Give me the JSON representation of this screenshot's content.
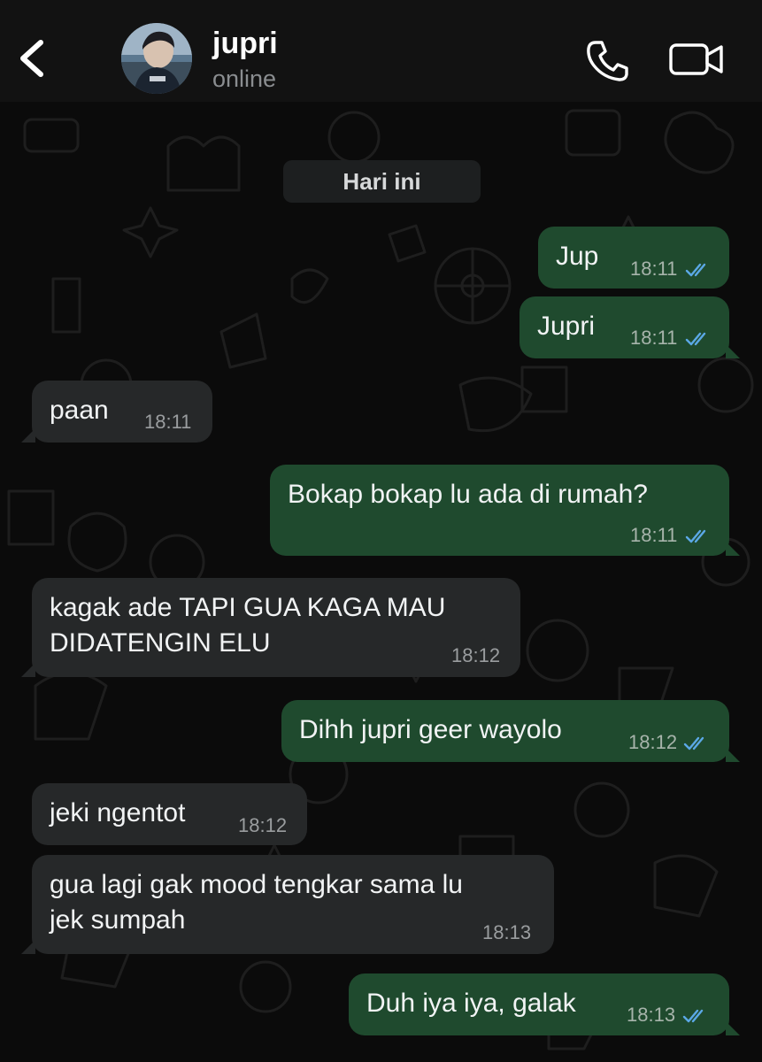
{
  "header": {
    "contact_name": "jupri",
    "status": "online",
    "icons": {
      "back": "chevron-left-icon",
      "call": "phone-icon",
      "video": "video-camera-icon"
    }
  },
  "chat": {
    "date_label": "Hari ini",
    "messages": [
      {
        "direction": "out",
        "text": "Jup",
        "time": "18:11",
        "read": true
      },
      {
        "direction": "out",
        "text": "Jupri",
        "time": "18:11",
        "read": true
      },
      {
        "direction": "in",
        "text": "paan",
        "time": "18:11"
      },
      {
        "direction": "out",
        "text": "Bokap bokap lu ada di rumah?",
        "time": "18:11",
        "read": true
      },
      {
        "direction": "in",
        "text": "kagak ade TAPI GUA KAGA MAU\nDIDATENGIN ELU",
        "time": "18:12"
      },
      {
        "direction": "out",
        "text": "Dihh jupri geer wayolo",
        "time": "18:12",
        "read": true
      },
      {
        "direction": "in",
        "text": "jeki ngentot",
        "time": "18:12"
      },
      {
        "direction": "in",
        "text": "gua lagi gak mood tengkar sama lu\njek sumpah",
        "time": "18:13"
      },
      {
        "direction": "out",
        "text": "Duh iya iya, galak",
        "time": "18:13",
        "read": true
      }
    ]
  },
  "colors": {
    "outgoing_bubble": "#1f4a2e",
    "incoming_bubble": "#262829",
    "read_ticks": "#5ba8e6",
    "header_bg": "#121212"
  }
}
